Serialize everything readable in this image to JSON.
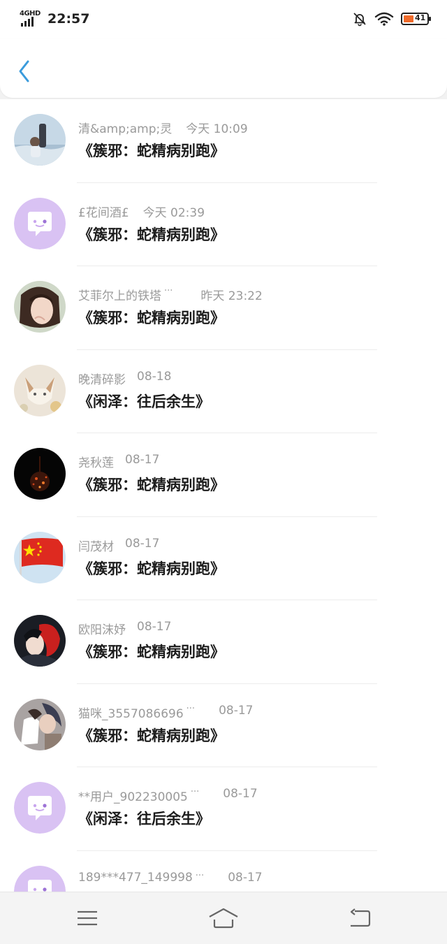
{
  "status": {
    "network": "4GHD",
    "time": "22:57",
    "battery_level": "41"
  },
  "comments": [
    {
      "user": "清&amp;amp;灵",
      "truncated": false,
      "time": "今天 10:09",
      "work": "《簇邪：蛇精病别跑》",
      "avatar": "photo-sea",
      "time_gap": 20
    },
    {
      "user": "£花间酒£",
      "truncated": false,
      "time": "今天 02:39",
      "work": "《簇邪：蛇精病别跑》",
      "avatar": "default-chat",
      "time_gap": 20
    },
    {
      "user": "艾菲尔上的铁塔",
      "truncated": true,
      "time": "昨天 23:22",
      "work": "《簇邪：蛇精病别跑》",
      "avatar": "photo-girl",
      "time_gap": 40
    },
    {
      "user": "晚清碎影",
      "truncated": false,
      "time": "08-18",
      "work": "《闲泽：往后余生》",
      "avatar": "photo-fox",
      "time_gap": 16
    },
    {
      "user": "尧秋莲",
      "truncated": false,
      "time": "08-17",
      "work": "《簇邪：蛇精病别跑》",
      "avatar": "photo-dark",
      "time_gap": 16
    },
    {
      "user": "闫茂材",
      "truncated": false,
      "time": "08-17",
      "work": "《簇邪：蛇精病别跑》",
      "avatar": "photo-flag",
      "time_gap": 16
    },
    {
      "user": "欧阳沫妤",
      "truncated": false,
      "time": "08-17",
      "work": "《簇邪：蛇精病别跑》",
      "avatar": "photo-redhair",
      "time_gap": 16
    },
    {
      "user": "猫咪_3557086696",
      "truncated": true,
      "time": "08-17",
      "work": "《簇邪：蛇精病别跑》",
      "avatar": "photo-anime",
      "time_gap": 34
    },
    {
      "user": "**用户_902230005",
      "truncated": true,
      "time": "08-17",
      "work": "《闲泽：往后余生》",
      "avatar": "default-chat",
      "time_gap": 34
    },
    {
      "user": "189***477_149998",
      "truncated": true,
      "time": "08-17",
      "work": "",
      "avatar": "default-chat",
      "time_gap": 34
    }
  ],
  "colors": {
    "accent": "#3a9bdc",
    "default_avatar": "#d9c2f3",
    "battery_fill": "#ef6a2a",
    "meta_text": "#9a9a9a",
    "title_text": "#1c1c1c"
  },
  "icons": {
    "back": "chevron-left-icon",
    "menu": "menu-icon",
    "home": "home-icon",
    "return": "return-icon"
  }
}
